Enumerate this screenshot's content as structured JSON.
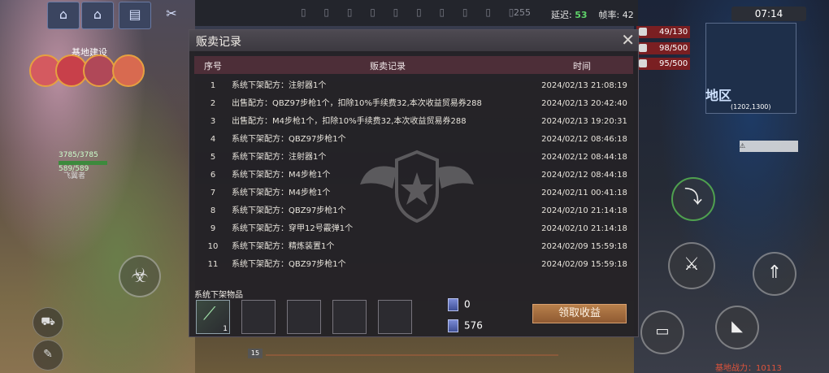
{
  "hud": {
    "top_number": "255",
    "latency_label": "延迟:",
    "latency_value": "53",
    "fps_label": "帧率:",
    "fps_value": "42",
    "clock": "07:14",
    "base_build_label": "基地建设",
    "hp": "3785/3785",
    "hp_sub": "589/589",
    "player_label": "飞翼者",
    "stats": [
      {
        "value": "49/130",
        "color": "#7a1f22"
      },
      {
        "value": "98/500",
        "color": "#7a1f22"
      },
      {
        "value": "95/500",
        "color": "#7a1f22"
      }
    ],
    "zone_label": "地区",
    "coords": "(1202,1300)",
    "base_power": "基地战力：10113",
    "level": "15"
  },
  "dialog": {
    "title": "贩卖记录",
    "close_icon": "close-icon",
    "columns": [
      "序号",
      "贩卖记录",
      "时间"
    ],
    "rows": [
      {
        "idx": "1",
        "text": "系统下架配方：注射器1个",
        "time": "2024/02/13 21:08:19"
      },
      {
        "idx": "2",
        "text": "出售配方：QBZ97步枪1个，扣除10%手续费32,本次收益贸易券288",
        "time": "2024/02/13 20:42:40"
      },
      {
        "idx": "3",
        "text": "出售配方：M4步枪1个，扣除10%手续费32,本次收益贸易券288",
        "time": "2024/02/13 19:20:31"
      },
      {
        "idx": "4",
        "text": "系统下架配方：QBZ97步枪1个",
        "time": "2024/02/12 08:46:18"
      },
      {
        "idx": "5",
        "text": "系统下架配方：注射器1个",
        "time": "2024/02/12 08:44:18"
      },
      {
        "idx": "6",
        "text": "系统下架配方：M4步枪1个",
        "time": "2024/02/12 08:44:18"
      },
      {
        "idx": "7",
        "text": "系统下架配方：M4步枪1个",
        "time": "2024/02/11 00:41:18"
      },
      {
        "idx": "8",
        "text": "系统下架配方：QBZ97步枪1个",
        "time": "2024/02/10 21:14:18"
      },
      {
        "idx": "9",
        "text": "系统下架配方：穿甲12号霰弹1个",
        "time": "2024/02/10 21:14:18"
      },
      {
        "idx": "10",
        "text": "系统下架配方：精炼装置1个",
        "time": "2024/02/09 15:59:18"
      },
      {
        "idx": "11",
        "text": "系统下架配方：QBZ97步枪1个",
        "time": "2024/02/09 15:59:18"
      }
    ],
    "removed_items_label": "系统下架物品",
    "slots": [
      {
        "filled": true,
        "qty": "1"
      },
      {
        "filled": false,
        "qty": ""
      },
      {
        "filled": false,
        "qty": ""
      },
      {
        "filled": false,
        "qty": ""
      },
      {
        "filled": false,
        "qty": ""
      }
    ],
    "currency_a": "0",
    "currency_b": "576",
    "claim_button": "领取收益"
  }
}
